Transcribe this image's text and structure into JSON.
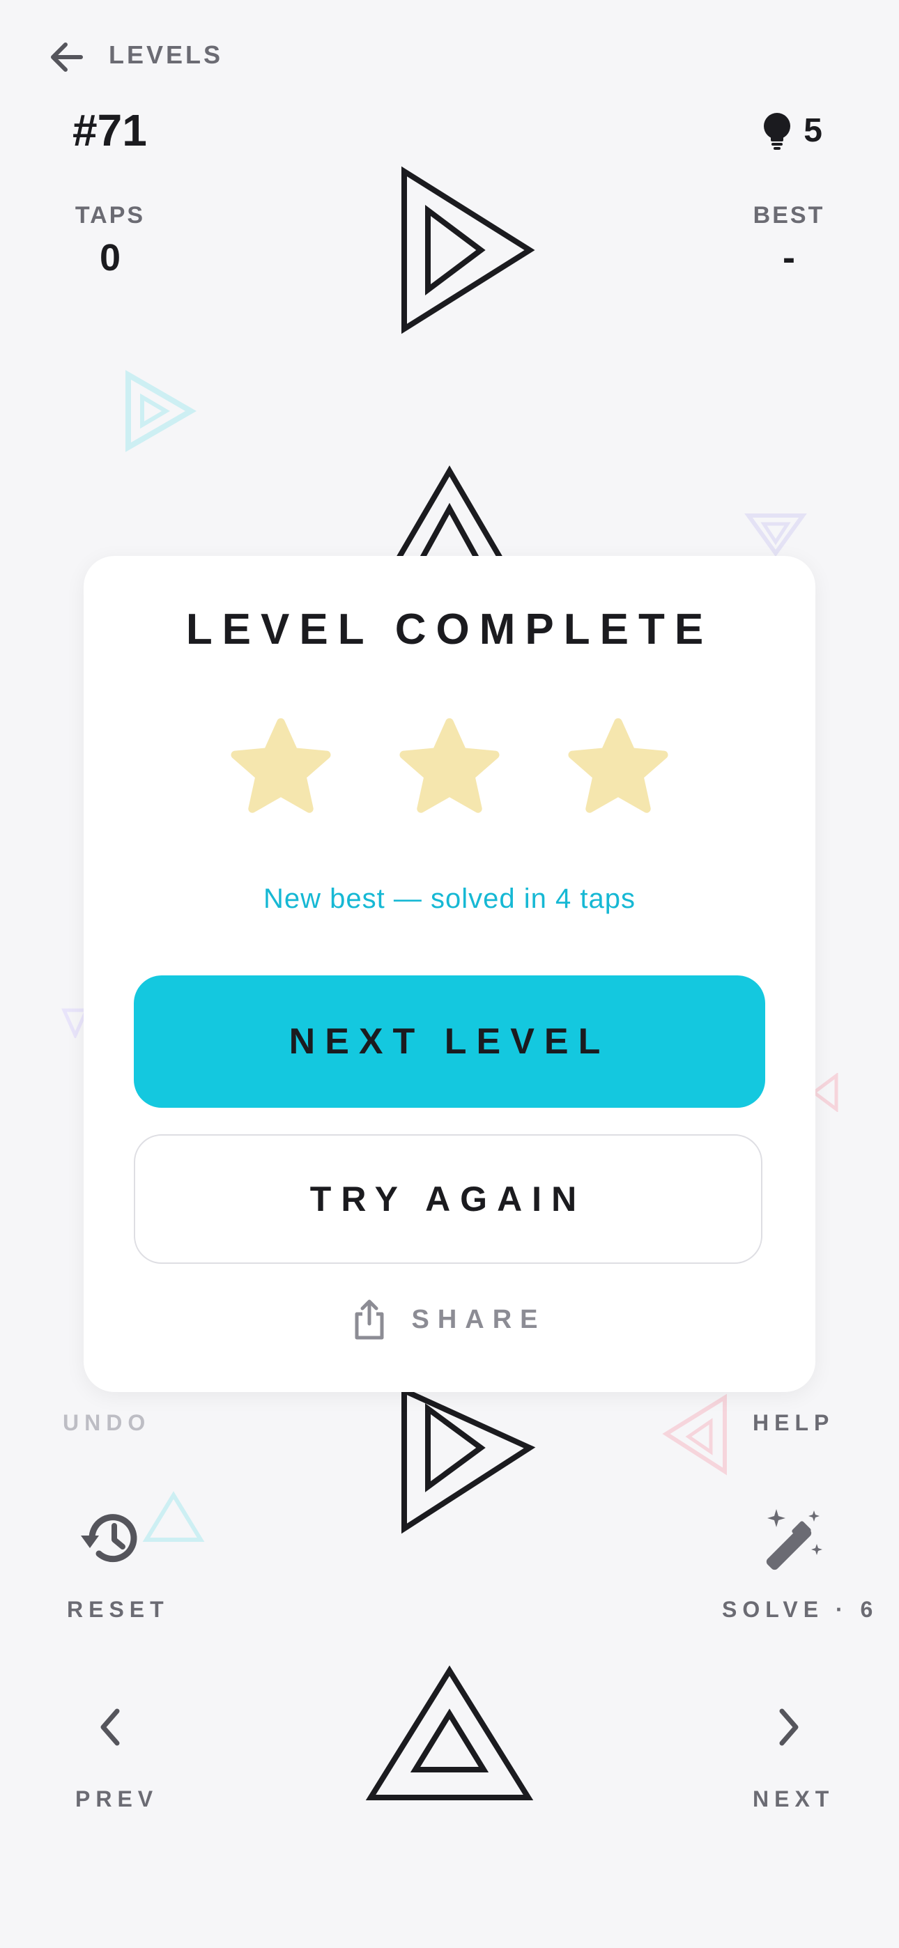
{
  "header": {
    "back_label": "LEVELS",
    "level_number": "#71",
    "hints_count": "5"
  },
  "stats": {
    "taps_label": "TAPS",
    "taps_value": "0",
    "best_label": "BEST",
    "best_value": "-"
  },
  "controls": {
    "undo_label": "UNDO",
    "help_label": "HELP",
    "reset_label": "RESET",
    "solve_label": "SOLVE · 6",
    "prev_label": "PREV",
    "next_label": "NEXT"
  },
  "modal": {
    "title": "LEVEL COMPLETE",
    "stars_earned": 3,
    "stars_total": 3,
    "message": "New best — solved in 4 taps",
    "next_button": "NEXT LEVEL",
    "try_again_button": "TRY AGAIN",
    "share_label": "SHARE"
  },
  "colors": {
    "accent": "#14c8df",
    "star": "#f5e6ae",
    "background": "#f6f6f8",
    "ink": "#1b1b1f"
  }
}
